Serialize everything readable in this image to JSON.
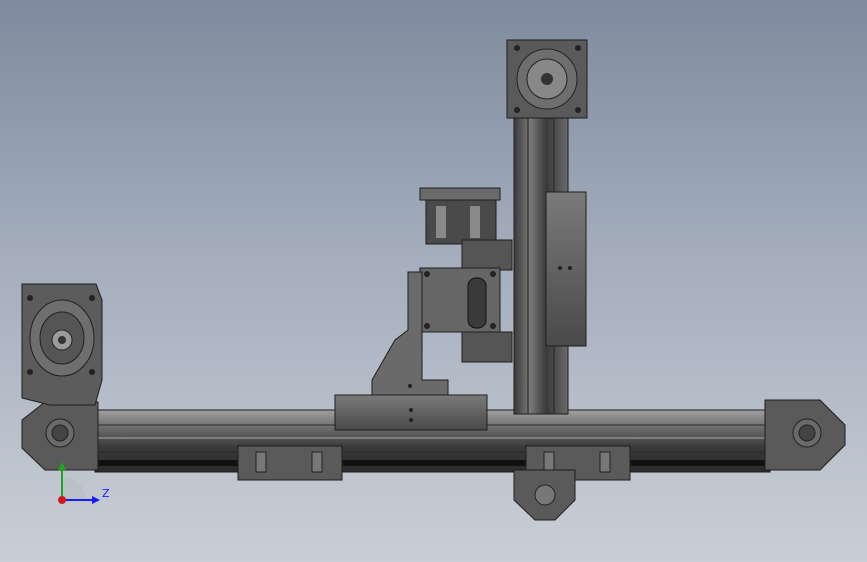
{
  "viewport": {
    "background_top": "#7f8a9e",
    "background_bottom": "#c9cfd7",
    "part_colors": {
      "metal_dark": "#3c3c3c",
      "metal_mid": "#5a5a5a",
      "metal_light": "#8c8c8c",
      "edge": "#1e1e1e"
    }
  },
  "triad": {
    "z_label": "Z",
    "z_color": "#1a1aff",
    "y_color": "#1aa81a",
    "origin_color": "#d01a1a"
  }
}
